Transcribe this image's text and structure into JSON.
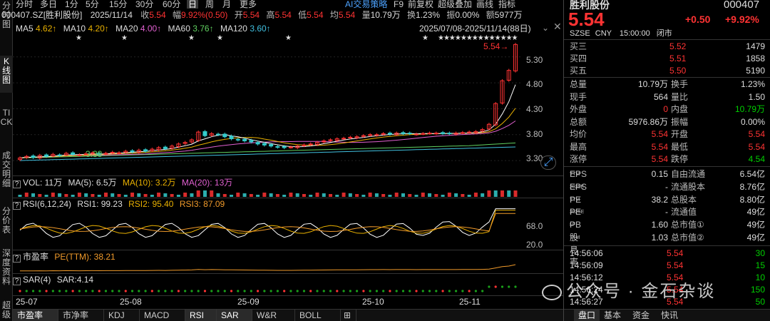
{
  "vtabs": [
    "分时图",
    "K线图",
    "TICK",
    "成交明细",
    "分价表",
    "深度资料",
    "超级"
  ],
  "periods": [
    "分时",
    "多日",
    "1分",
    "5分",
    "15分",
    "30分",
    "60分",
    "日",
    "周",
    "月",
    "更多"
  ],
  "periods_active": "日",
  "toolbar": {
    "ai": "AI交易策略",
    "f9": "F9",
    "fuquan": "前复权",
    "overlay": "超级叠加",
    "draw": "画线",
    "indicator": "指标"
  },
  "info": {
    "code": "000407.SZ[胜利股份]",
    "date": "2025/11/14",
    "close_label": "收",
    "close": "5.54",
    "change_label": "幅",
    "change": "9.92%(0.50)",
    "open_label": "开",
    "open": "5.54",
    "high_label": "高",
    "high": "5.54",
    "low_label": "低",
    "low": "5.54",
    "avg_label": "均",
    "avg": "5.54",
    "vol_label": "量",
    "vol": "10.79万",
    "turn_label": "换",
    "turn": "1.23%",
    "amp_label": "振",
    "amp": "0.00%",
    "amt_label": "额",
    "amt": "5977万"
  },
  "ma": {
    "ma5": "MA5",
    "ma5v": "4.62↑",
    "ma10": "MA10",
    "ma10v": "4.20↑",
    "ma20": "MA20",
    "ma20v": "4.00↑",
    "ma60": "MA60",
    "ma60v": "3.76↑",
    "ma120": "MA120",
    "ma120v": "3.60↑",
    "range": "2025/07/08-2025/11/14(88日)"
  },
  "price_axis": [
    "5.30",
    "4.80",
    "4.30",
    "3.80",
    "3.30"
  ],
  "price_marks": {
    "high": "5.54→",
    "low": "3.38"
  },
  "vol_legend": {
    "q": "?",
    "vol": "VOL: 11万",
    "ma5": "MA(5): 6.5万",
    "ma10": "MA(10): 3.2万",
    "ma20": "MA(20): 13万"
  },
  "rsi_legend": {
    "q": "?",
    "name": "RSI(6,12,24)",
    "rsi1": "RSI1: 99.23",
    "rsi2": "RSI2: 95.40",
    "rsi3": "RSI3: 87.09"
  },
  "rsi_axis": [
    "68.0",
    "20.0"
  ],
  "pe_legend": {
    "q": "?",
    "name": "市盈率",
    "pe": "PE(TTM): 38.21"
  },
  "sar_legend": {
    "q": "?",
    "name": "SAR(4)",
    "sar": "SAR:4.14"
  },
  "x_axis": [
    "25-07",
    "25-08",
    "25-09",
    "25-10",
    "25-11"
  ],
  "bottom_tabs": [
    "市盈率",
    "市净率",
    "KDJ",
    "MACD",
    "RSI",
    "SAR",
    "W&R",
    "BOLL",
    "⊞"
  ],
  "bottom_tabs_active": [
    "市盈率",
    "RSI",
    "SAR"
  ],
  "panel": {
    "name": "胜利股份",
    "code": "000407",
    "price": "5.54",
    "chg": "+0.50",
    "pct": "+9.92%",
    "exch": "SZSE",
    "cur": "CNY",
    "time": "15:00:00",
    "status": "闭市",
    "asks": [
      {
        "label": "买三",
        "price": "5.52",
        "vol": "1479"
      },
      {
        "label": "买四",
        "price": "5.51",
        "vol": "1858"
      },
      {
        "label": "买五",
        "price": "5.50",
        "vol": "5190"
      }
    ],
    "stats": [
      {
        "l1": "总量",
        "v1": "10.79万",
        "c1": "white",
        "l2": "换手",
        "v2": "1.23%",
        "c2": "white"
      },
      {
        "l1": "现手",
        "v1": "564",
        "c1": "white",
        "l2": "量比",
        "v2": "1.50",
        "c2": "white"
      },
      {
        "l1": "外盘",
        "v1": "0",
        "c1": "red",
        "l2": "内盘",
        "v2": "10.79万",
        "c2": "green"
      },
      {
        "l1": "总额",
        "v1": "5976.86万",
        "c1": "white",
        "l2": "振幅",
        "v2": "0.00%",
        "c2": "white"
      },
      {
        "l1": "均价",
        "v1": "5.54",
        "c1": "red",
        "l2": "开盘",
        "v2": "5.54",
        "c2": "red"
      },
      {
        "l1": "最高",
        "v1": "5.54",
        "c1": "red",
        "l2": "最低",
        "v2": "5.54",
        "c2": "red"
      },
      {
        "l1": "涨停",
        "v1": "5.54",
        "c1": "red",
        "l2": "跌停",
        "v2": "4.54",
        "c2": "green"
      }
    ],
    "fund": [
      {
        "l1": "EPS",
        "s1": "TTM",
        "v1": "0.15",
        "l2": "自由流通",
        "v2": "6.54亿"
      },
      {
        "l1": "EPS",
        "s1": "2025E",
        "v1": "-",
        "l2": "流通股本",
        "v2": "8.76亿"
      },
      {
        "l1": "PE",
        "s1": "TTM",
        "v1": "38.2",
        "l2": "总股本",
        "v2": "8.80亿"
      },
      {
        "l1": "PE",
        "s1": "2025E",
        "v1": "-",
        "l2": "流通值",
        "v2": "49亿"
      },
      {
        "l1": "PB",
        "s1": "LF",
        "v1": "1.60",
        "l2": "总市值①",
        "v2": "49亿"
      },
      {
        "l1": "股息率",
        "s1": "TTM",
        "v1": "1.03",
        "l2": "总市值②",
        "v2": "49亿"
      }
    ],
    "ticks": [
      {
        "t": "14:56:06",
        "p": "5.54",
        "v": "30"
      },
      {
        "t": "14:56:09",
        "p": "5.54",
        "v": "15"
      },
      {
        "t": "14:56:12",
        "p": "5.54",
        "v": "10"
      },
      {
        "t": "14:56:24",
        "p": "5.54",
        "v": "150"
      },
      {
        "t": "14:56:27",
        "p": "5.54",
        "v": "50"
      }
    ],
    "tabs": [
      "盘口",
      "基本",
      "资金",
      "快讯"
    ],
    "tabs_active": "盘口"
  },
  "watermark": "公众号 · 金石杂谈",
  "candles": [
    3.35,
    3.38,
    3.36,
    3.4,
    3.38,
    3.42,
    3.4,
    3.44,
    3.42,
    3.41,
    3.43,
    3.45,
    3.42,
    3.44,
    3.46,
    3.45,
    3.48,
    3.47,
    3.5,
    3.48,
    3.52,
    3.55,
    3.53,
    3.58,
    3.62,
    3.65,
    3.7,
    3.85,
    3.78,
    3.82,
    3.8,
    3.76,
    3.72,
    3.7,
    3.68,
    3.66,
    3.62,
    3.6,
    3.58,
    3.56,
    3.55,
    3.56,
    3.58,
    3.6,
    3.62,
    3.65,
    3.68,
    3.7,
    3.72,
    3.73,
    3.75,
    3.76,
    3.78,
    3.8,
    3.8,
    3.82,
    3.81,
    3.83,
    3.82,
    3.82,
    3.81,
    3.82,
    3.83,
    3.83,
    3.82,
    3.82,
    3.83,
    3.84,
    3.85,
    3.86,
    3.9,
    4.0,
    4.4,
    4.84,
    5.04,
    5.54
  ]
}
